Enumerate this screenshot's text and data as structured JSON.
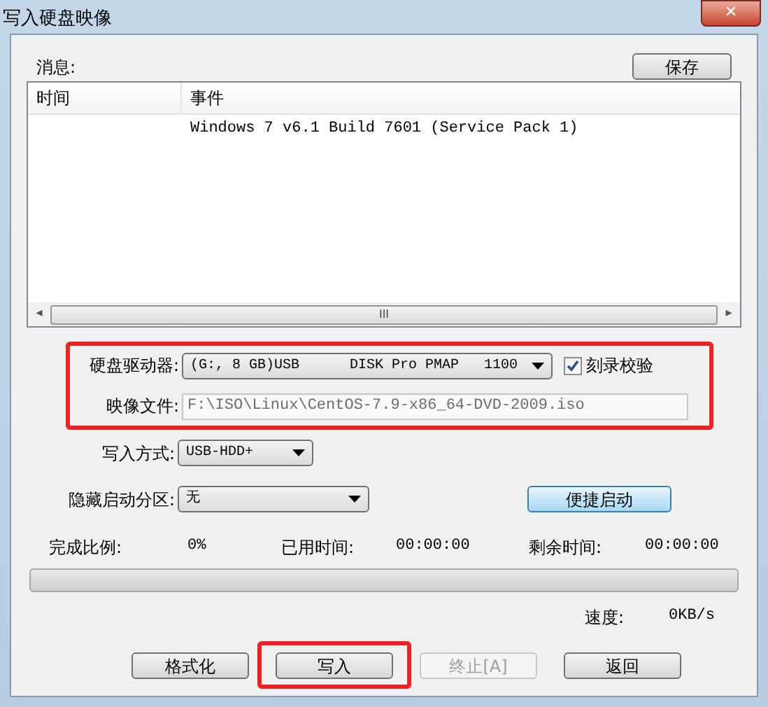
{
  "window": {
    "title": "写入硬盘映像",
    "close": "✕"
  },
  "messages": {
    "label": "消息:",
    "save_button": "保存",
    "columns": [
      "时间",
      "事件"
    ],
    "rows": [
      {
        "time_cell": "",
        "event": "Windows 7 v6.1 Build 7601 (Service Pack 1)"
      }
    ],
    "scroll_grip": "III",
    "scroll_left": "◂",
    "scroll_right": "▸"
  },
  "drive_group": {
    "highlighted": true,
    "drive_label": "硬盘驱动器:",
    "drive_value": "(G:, 8 GB)USB      DISK Pro PMAP   1100",
    "verify": {
      "label": "刻录校验",
      "checked": true
    },
    "image_label": "映像文件:",
    "image_value": "F:\\ISO\\Linux\\CentOS-7.9-x86_64-DVD-2009.iso"
  },
  "write_mode": {
    "label": "写入方式:",
    "value": "USB-HDD+"
  },
  "hidden_partition": {
    "label": "隐藏启动分区:",
    "value": "无"
  },
  "quick_boot_button": "便捷启动",
  "stats": [
    {
      "label": "完成比例:",
      "value": "0%"
    },
    {
      "label": "已用时间:",
      "value": "00:00:00"
    },
    {
      "label": "剩余时间:",
      "value": "00:00:00"
    }
  ],
  "progress": {
    "level": 0
  },
  "speed": {
    "label": "速度:",
    "value": "0KB/s"
  },
  "buttons": [
    {
      "label": "格式化",
      "disabled": false,
      "highlighted": false
    },
    {
      "label": "写入",
      "disabled": false,
      "highlighted": true
    },
    {
      "label": "终止[A]",
      "disabled": true,
      "highlighted": false
    },
    {
      "label": "返回",
      "disabled": false,
      "highlighted": false
    }
  ]
}
